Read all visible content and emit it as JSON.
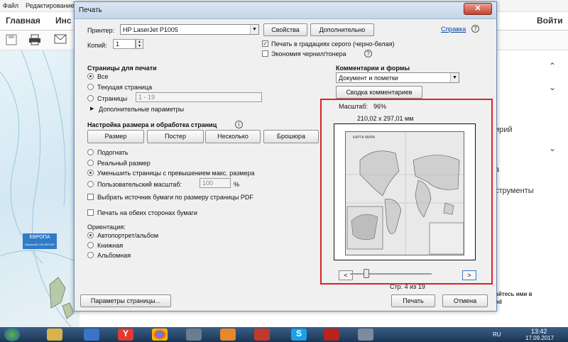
{
  "app": {
    "menu": [
      "Файл",
      "Редактирование"
    ],
    "tabs": [
      "Главная",
      "Инс",
      "Войти"
    ],
    "right_panel": [
      "ирий",
      "а",
      "струменты",
      "вйтесь ими в",
      "ud"
    ],
    "map_label": "ЕВРОПА",
    "map_scale": "Масштаб 1:40 000 000"
  },
  "dialog": {
    "title": "Печать",
    "close_label": "✕",
    "printer_label": "Принтер:",
    "printer_value": "HP LaserJet P1005",
    "properties_btn": "Свойства",
    "advanced_btn": "Дополнительно",
    "help_link": "Справка",
    "copies_label": "Копий:",
    "copies_value": "1",
    "grayscale_label": "Печать в градациях серого (черно-белая)",
    "grayscale_checked": true,
    "save_ink_label": "Экономия чернил/тонера",
    "save_ink_checked": false,
    "pages_header": "Страницы для печати",
    "pages_options": [
      "Все",
      "Текущая страница",
      "Страницы"
    ],
    "pages_selected": 0,
    "pages_range": "1 - 19",
    "more_options": "Дополнительные параметры",
    "sizing_header": "Настройка размера и обработка страниц",
    "sizing_buttons": [
      "Размер",
      "Постер",
      "Несколько",
      "Брошюра"
    ],
    "fit_options": [
      "Подогнать",
      "Реальный размер",
      "Уменьшить страницы с превышением макс. размера",
      "Пользовательский масштаб:"
    ],
    "fit_selected": 2,
    "custom_scale": "100",
    "percent": "%",
    "paper_source_label": "Выбрать источник бумаги по размеру страницы PDF",
    "duplex_label": "Печать на обеих сторонах бумаги",
    "orientation_header": "Ориентация:",
    "orientation_options": [
      "Автопортрет/альбом",
      "Книжная",
      "Альбомная"
    ],
    "orientation_selected": 0,
    "comments_header": "Комментарии и формы",
    "comments_value": "Документ и пометки",
    "summarize_btn": "Сводка комментариев",
    "scale_label": "Масштаб:",
    "scale_value": "96%",
    "paper_size": "210,02 x 297,01 мм",
    "map_title": "КАРТА МИРА",
    "prev_label": "<",
    "next_label": ">",
    "page_label": "Стр. 4 из 19",
    "page_setup_btn": "Параметры страницы...",
    "print_btn": "Печать",
    "cancel_btn": "Отмена"
  },
  "taskbar": {
    "lang": "RU",
    "time": "13:42",
    "date": "17.09.2017"
  }
}
